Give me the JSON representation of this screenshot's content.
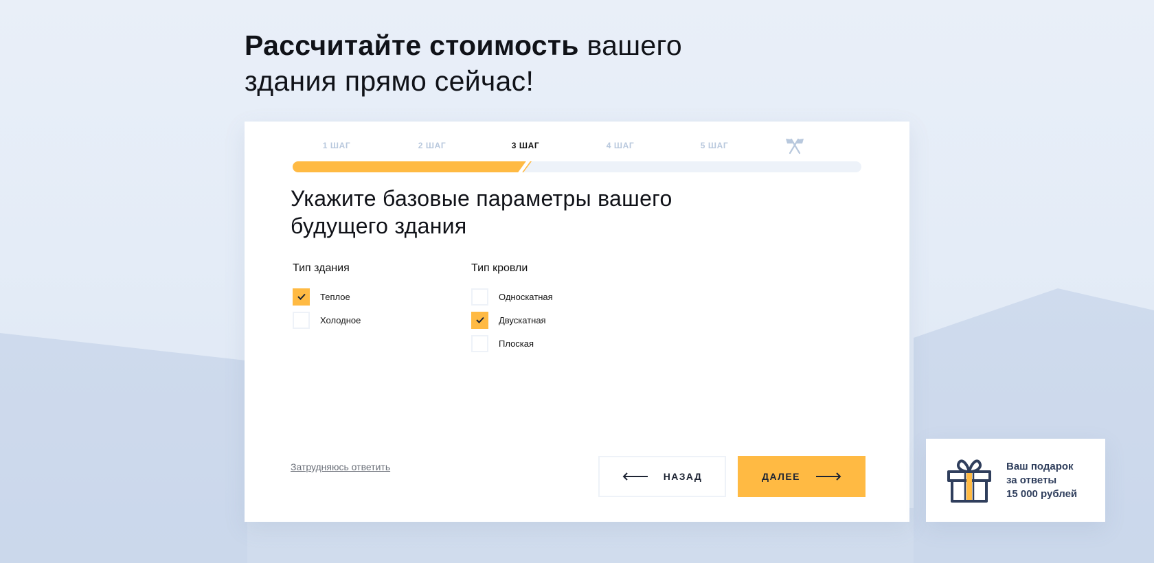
{
  "page": {
    "title_bold": "Рассчитайте стоимость",
    "title_regular": " вашего здания прямо сейчас!"
  },
  "quiz": {
    "steps": [
      "1 ШАГ",
      "2 ШАГ",
      "3 ШАГ",
      "4 ШАГ",
      "5 ШАГ"
    ],
    "active_step": 3,
    "progress_percent": 42,
    "finish_icon": "flags-icon",
    "question": "Укажите базовые параметры вашего будущего здания",
    "groups": {
      "building_type": {
        "label": "Тип здания",
        "options": [
          {
            "label": "Теплое",
            "checked": true
          },
          {
            "label": "Холодное",
            "checked": false
          }
        ]
      },
      "roof_type": {
        "label": "Тип кровли",
        "options": [
          {
            "label": "Односкатная",
            "checked": false
          },
          {
            "label": "Двускатная",
            "checked": true
          },
          {
            "label": "Плоская",
            "checked": false
          }
        ]
      }
    },
    "skip_label": "Затрудняюсь ответить",
    "back_label": "НАЗАД",
    "next_label": "ДАЛЕЕ"
  },
  "gift": {
    "icon": "gift-icon",
    "text": "Ваш подарок\nза ответы\n15 000 рублей"
  },
  "colors": {
    "accent": "#ffba43",
    "inactive_step": "#b8c8dd",
    "track": "#edf2f9",
    "gift_icon": "#2f3e5c",
    "gift_ribbon": "#ffba43"
  }
}
